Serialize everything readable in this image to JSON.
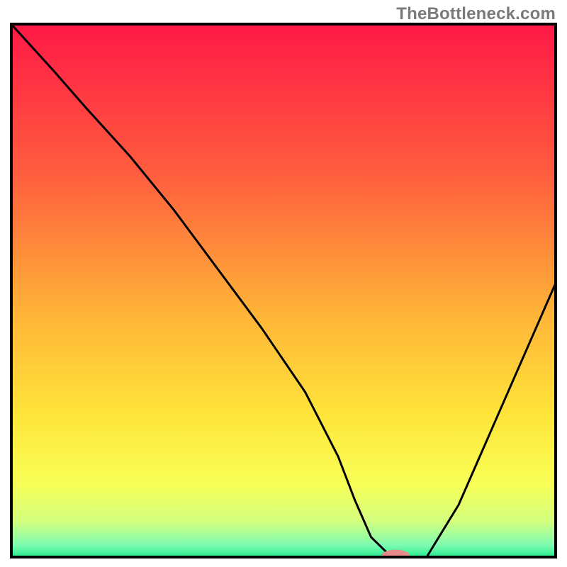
{
  "watermark": {
    "text": "TheBottleneck.com"
  },
  "chart_data": {
    "type": "line",
    "title": "",
    "xlabel": "",
    "ylabel": "",
    "xlim": [
      0,
      100
    ],
    "ylim": [
      0,
      100
    ],
    "gradient_stops": [
      {
        "offset": 0.0,
        "color": "#ff1846"
      },
      {
        "offset": 0.28,
        "color": "#ff5d3e"
      },
      {
        "offset": 0.55,
        "color": "#ffb638"
      },
      {
        "offset": 0.73,
        "color": "#ffe43a"
      },
      {
        "offset": 0.86,
        "color": "#f8ff56"
      },
      {
        "offset": 0.93,
        "color": "#d4ff7e"
      },
      {
        "offset": 0.975,
        "color": "#7efcb1"
      },
      {
        "offset": 1.0,
        "color": "#1bea8c"
      }
    ],
    "series": [
      {
        "name": "bottleneck-curve",
        "x": [
          0,
          8,
          14,
          22,
          30,
          38,
          46,
          54,
          60,
          63,
          66,
          69,
          72,
          76,
          82,
          88,
          94,
          100
        ],
        "y": [
          100,
          91,
          84,
          75,
          65,
          54,
          43,
          31,
          19,
          11,
          4,
          1,
          0,
          0,
          10,
          24,
          38,
          52
        ]
      }
    ],
    "marker": {
      "name": "optimal-point",
      "x": 70.5,
      "y": 0,
      "rx": 2.6,
      "ry": 1.1,
      "fill": "#e68a8a"
    },
    "frame": {
      "stroke": "#000000",
      "stroke_width": 8
    }
  }
}
